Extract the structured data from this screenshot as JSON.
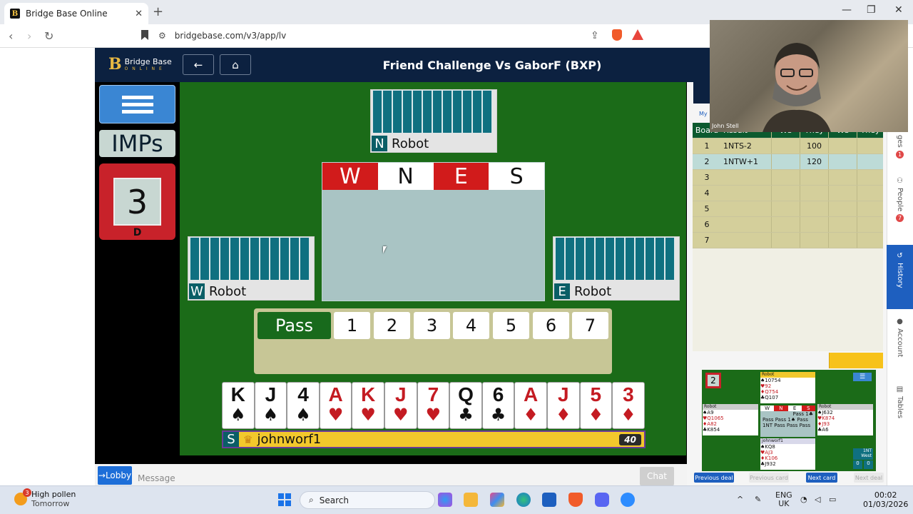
{
  "browser": {
    "tab_title": "Bridge Base Online",
    "url": "bridgebase.com/v3/app/lv"
  },
  "header": {
    "logo_text": "Bridge Base",
    "logo_sub": "O N L I N E",
    "title": "Friend Challenge Vs GaborF (BXP)"
  },
  "sidebar": {
    "scoring": "IMPs",
    "board_number": "3",
    "dealer": "D"
  },
  "seats": {
    "north": {
      "dir": "N",
      "name": "Robot"
    },
    "west": {
      "dir": "W",
      "name": "Robot"
    },
    "east": {
      "dir": "E",
      "name": "Robot"
    },
    "south": {
      "dir": "S",
      "name": "johnworf1",
      "timer": "40"
    }
  },
  "bidding_header": [
    "W",
    "N",
    "E",
    "S"
  ],
  "call_box": {
    "pass_label": "Pass",
    "levels": [
      "1",
      "2",
      "3",
      "4",
      "5",
      "6",
      "7"
    ]
  },
  "south_hand": [
    {
      "rank": "K",
      "suit": "♠",
      "color": "black"
    },
    {
      "rank": "J",
      "suit": "♠",
      "color": "black"
    },
    {
      "rank": "4",
      "suit": "♠",
      "color": "black"
    },
    {
      "rank": "A",
      "suit": "♥",
      "color": "red"
    },
    {
      "rank": "K",
      "suit": "♥",
      "color": "red"
    },
    {
      "rank": "J",
      "suit": "♥",
      "color": "red"
    },
    {
      "rank": "7",
      "suit": "♥",
      "color": "red"
    },
    {
      "rank": "Q",
      "suit": "♣",
      "color": "black"
    },
    {
      "rank": "6",
      "suit": "♣",
      "color": "black"
    },
    {
      "rank": "A",
      "suit": "♦",
      "color": "red"
    },
    {
      "rank": "J",
      "suit": "♦",
      "color": "red"
    },
    {
      "rank": "5",
      "suit": "♦",
      "color": "red"
    },
    {
      "rank": "3",
      "suit": "♦",
      "color": "red"
    }
  ],
  "chat": {
    "lobby_label": "→Lobby",
    "placeholder": "Message",
    "chat_label": "Chat"
  },
  "history": {
    "my_tab": "My",
    "headers": [
      "Board",
      "Result",
      "We",
      "They",
      "We",
      "They"
    ],
    "rows": [
      {
        "board": "1",
        "result": "1NTS-2",
        "they": "100"
      },
      {
        "board": "2",
        "result": "1NTW+1",
        "they": "120"
      },
      {
        "board": "3",
        "result": "",
        "they": ""
      },
      {
        "board": "4",
        "result": "",
        "they": ""
      },
      {
        "board": "5",
        "result": "",
        "they": ""
      },
      {
        "board": "6",
        "result": "",
        "they": ""
      },
      {
        "board": "7",
        "result": "",
        "they": ""
      }
    ]
  },
  "mini_deal": {
    "board": "2",
    "north": {
      "name": "Robot",
      "lines": [
        "♠10754",
        "♥92",
        "♦Q754",
        "♣Q107"
      ]
    },
    "west": {
      "name": "Robot",
      "lines": [
        "♠A9",
        "♥Q1065",
        "♦A82",
        "♣K854"
      ]
    },
    "east": {
      "name": "Robot",
      "lines": [
        "♠J632",
        "♥K874",
        "♦J93",
        "♣A6"
      ]
    },
    "south": {
      "name": "johnworf1",
      "lines": [
        "♠KQ8",
        "♥AJ3",
        "♦K106",
        "♣J932"
      ]
    },
    "auction_header": [
      "W",
      "N",
      "E",
      "S"
    ],
    "auction": [
      "Pass 1♣",
      "Pass Pass 1♠ Pass",
      "1NT Pass Pass Pass"
    ],
    "contract": "1NT",
    "declarer": "West",
    "tricks": [
      "0",
      "0"
    ]
  },
  "mini_buttons": {
    "prev_deal": "Previous deal",
    "prev_card": "Previous card",
    "next_card": "Next card",
    "next_deal": "Next deal"
  },
  "right_nav": {
    "messages": "ges",
    "people": "People",
    "history": "History",
    "account": "Account",
    "tables": "Tables",
    "badge1": "1",
    "badge2": "7"
  },
  "webcam": {
    "name": "John Stell"
  },
  "taskbar": {
    "weather_badge": "3",
    "weather_title": "High pollen",
    "weather_sub": "Tomorrow",
    "search_label": "Search",
    "lang1": "ENG",
    "lang2": "UK",
    "time": "00:02",
    "date": "01/03/2026"
  }
}
